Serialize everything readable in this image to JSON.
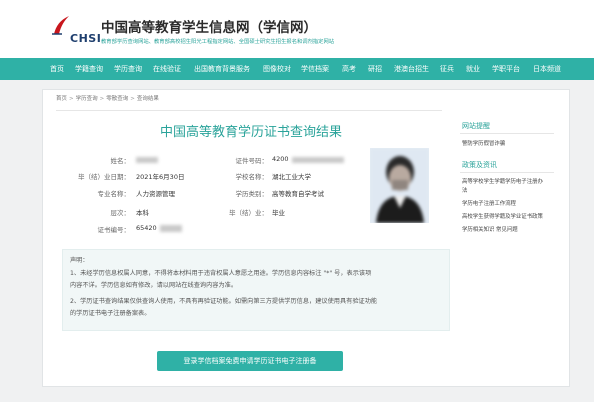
{
  "header": {
    "logo_text": "CHSI",
    "site_title": "中国高等教育学生信息网（学信网）",
    "site_subtitle": "教育部学历查询网站、教育部高校招生阳光工程指定网站、全国硕士研究生招生报名和调剂指定网站"
  },
  "nav": {
    "items": [
      "首页",
      "学籍查询",
      "学历查询",
      "在线验证",
      "出国教育背景服务",
      "图像校对",
      "学信档案",
      "高考",
      "研招",
      "港澳台招生",
      "征兵",
      "就业",
      "学职平台",
      "日本频道"
    ]
  },
  "breadcrumb": [
    "首页",
    "学历查询",
    "零散查询",
    "查询结果"
  ],
  "result": {
    "title": "中国高等教育学历证书查询结果",
    "labels": {
      "name": "姓名：",
      "certificate_no": "证件号码：",
      "graduation_date": "毕（结）业日期：",
      "school": "学校名称：",
      "major": "专业名称：",
      "edu_type": "学历类别：",
      "level": "层次：",
      "completion": "毕（结）业：",
      "cert_code": "证书编号："
    },
    "values": {
      "certificate_no": "4200",
      "graduation_date": "2021年6月30日",
      "school": "湖北工业大学",
      "major": "人力资源管理",
      "edu_type": "高等教育自学考试",
      "level": "本科",
      "completion": "毕业",
      "cert_code": "65420"
    }
  },
  "notice": {
    "heading": "声明：",
    "lines": [
      "1、未经学历信息权属人同意，不得将本材料用于违背权属人意愿之用途。学历信息内容标注 \"*\" 号，表示该项",
      "内容不详。学历信息如有修改，请以网站在线查询内容为准。",
      "2、学历证书查询结果仅供查询人使用，不具有再验证功能。如需向第三方提供学历信息，建议使用具有验证功能",
      "的学历证书电子注册备案表。"
    ]
  },
  "apply_button": "登录学信档案免费申请学历证书电子注册备",
  "sidebar": {
    "reminder_title": "网站提醒",
    "reminder_links": [
      "警防学历假冒诈骗"
    ],
    "policy_title": "政策及资讯",
    "policy_links": [
      "高等学校学生学籍学历电子注册办",
      "法",
      "学历电子注册工作流程",
      "高校学生获得学籍及学业证书政策",
      "学历相关知识    常见问题"
    ]
  },
  "colors": {
    "accent": "#2fb1a6",
    "title": "#2aa39a",
    "brand_dark": "#1f3f6e",
    "brand_red": "#c8161d"
  }
}
